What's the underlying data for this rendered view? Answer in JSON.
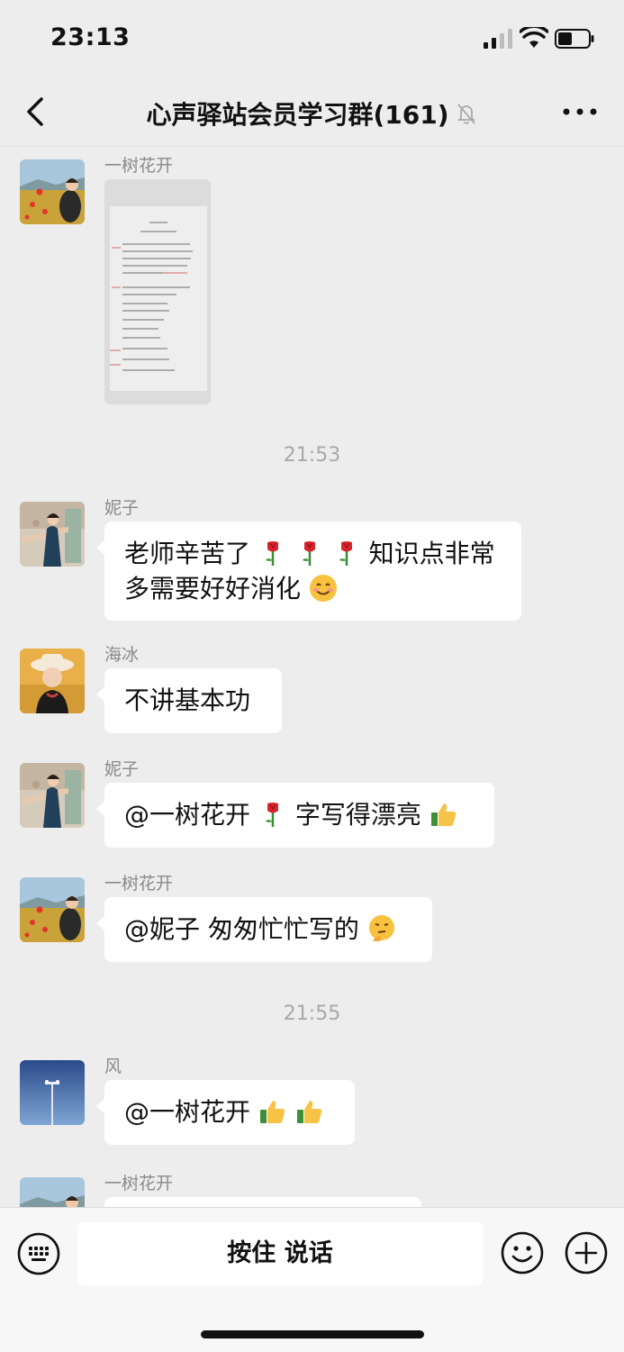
{
  "status_bar": {
    "time": "23:13"
  },
  "nav": {
    "title": "心声驿站会员学习群(161)"
  },
  "colors": {
    "background": "#ededed",
    "bubble": "#ffffff",
    "sender": "#8a8a8a",
    "timestamp": "#a9a9a9"
  },
  "messages": [
    {
      "sender": "一树花开",
      "type": "image",
      "avatar": "flower-field-avatar"
    },
    {
      "timestamp": "21:53"
    },
    {
      "sender": "妮子",
      "line1": "老师辛苦了",
      "line1b": "知识点非常",
      "line2": "多需要好好消化"
    },
    {
      "sender": "海冰",
      "text": "不讲基本功"
    },
    {
      "sender": "妮子",
      "text_a": "@一树花开 ",
      "text_b": "字写得漂亮"
    },
    {
      "sender": "一树花开",
      "text": "@妮子 匆匆忙忙写的"
    },
    {
      "timestamp": "21:55"
    },
    {
      "sender": "风",
      "text": "@一树花开 "
    },
    {
      "sender": "一树花开"
    }
  ],
  "input_bar": {
    "hold_to_talk": "按住 说话"
  },
  "icons": [
    "back-chevron-icon",
    "mute-bell-icon",
    "more-dots-icon",
    "rose-icon",
    "smile-emoji-icon",
    "thumbs-up-icon",
    "thinking-emoji-icon",
    "keyboard-icon",
    "emoji-face-icon",
    "plus-circle-icon"
  ]
}
